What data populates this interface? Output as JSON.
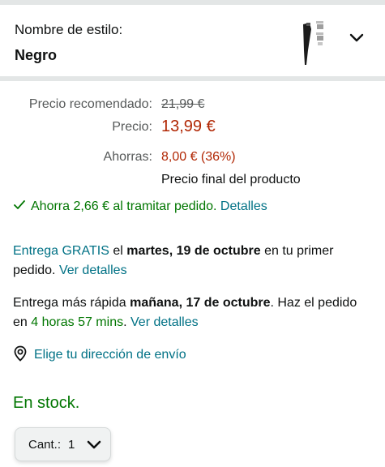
{
  "style": {
    "label": "Nombre de estilo:",
    "value": "Negro",
    "thumbnail_icon": "hair-clipper-thumbnail",
    "chevron_icon": "chevron-down-icon"
  },
  "pricing": {
    "recommended_label": "Precio recomendado:",
    "recommended_value": "21,99 €",
    "price_label": "Precio:",
    "price_value": "13,99 €",
    "savings_label": "Ahorras:",
    "savings_value": "8,00 € (36%)",
    "final_note": "Precio final del producto"
  },
  "promo": {
    "icon": "checkmark-icon",
    "text": "Ahorra 2,66 € al tramitar pedido.",
    "link": "Detalles"
  },
  "delivery": {
    "free_link": "Entrega GRATIS",
    "free_el": "el",
    "free_date": "martes, 19 de octubre",
    "free_suffix": "en tu primer pedido.",
    "free_details": "Ver detalles",
    "fast_prefix": "Entrega más rápida",
    "fast_date": "mañana, 17 de octubre",
    "fast_mid": ". Haz el pedido en",
    "fast_countdown": "4 horas 57 mins",
    "fast_dot": ".",
    "fast_details": "Ver detalles"
  },
  "address": {
    "icon": "location-pin-icon",
    "label": "Elige tu dirección de envío"
  },
  "stock": "En stock.",
  "quantity": {
    "label": "Cant.:",
    "value": "1",
    "chevron_icon": "chevron-down-icon"
  },
  "colors": {
    "price_red": "#B12704",
    "stock_green": "#007600",
    "link_teal": "#007185",
    "divider_gray": "#e3e6e6"
  }
}
